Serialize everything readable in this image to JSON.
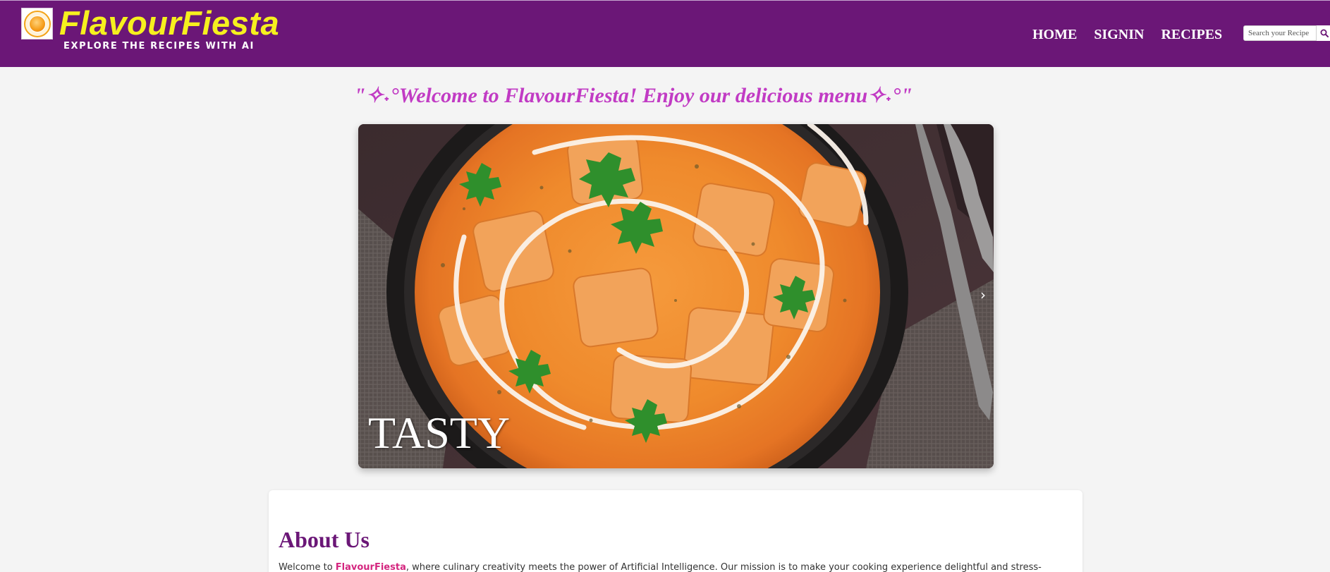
{
  "header": {
    "brand": "FlavourFiesta",
    "tagline": "EXPLORE THE RECIPES WITH AI",
    "nav": [
      {
        "label": "HOME"
      },
      {
        "label": "SIGNIN"
      },
      {
        "label": "RECIPES"
      }
    ],
    "search": {
      "placeholder": "Search your Recipe",
      "icon": "search-icon"
    },
    "colors": {
      "background": "#6b1777",
      "brand": "#f6f01e"
    }
  },
  "welcome": {
    "text": "\"✧˖°Welcome to FlavourFiesta! Enjoy our delicious menu✧˖°\"",
    "color": "#c13bc4"
  },
  "carousel": {
    "caption": "TASTY",
    "next_icon": "chevron-right-icon",
    "next_glyph": "›"
  },
  "about": {
    "title": "About Us",
    "text_prefix": "Welcome to ",
    "text_highlight": "FlavourFiesta",
    "text_suffix": ", where culinary creativity meets the power of Artificial Intelligence. Our mission is to make your cooking experience delightful and stress-",
    "highlight_color": "#d4267f"
  }
}
